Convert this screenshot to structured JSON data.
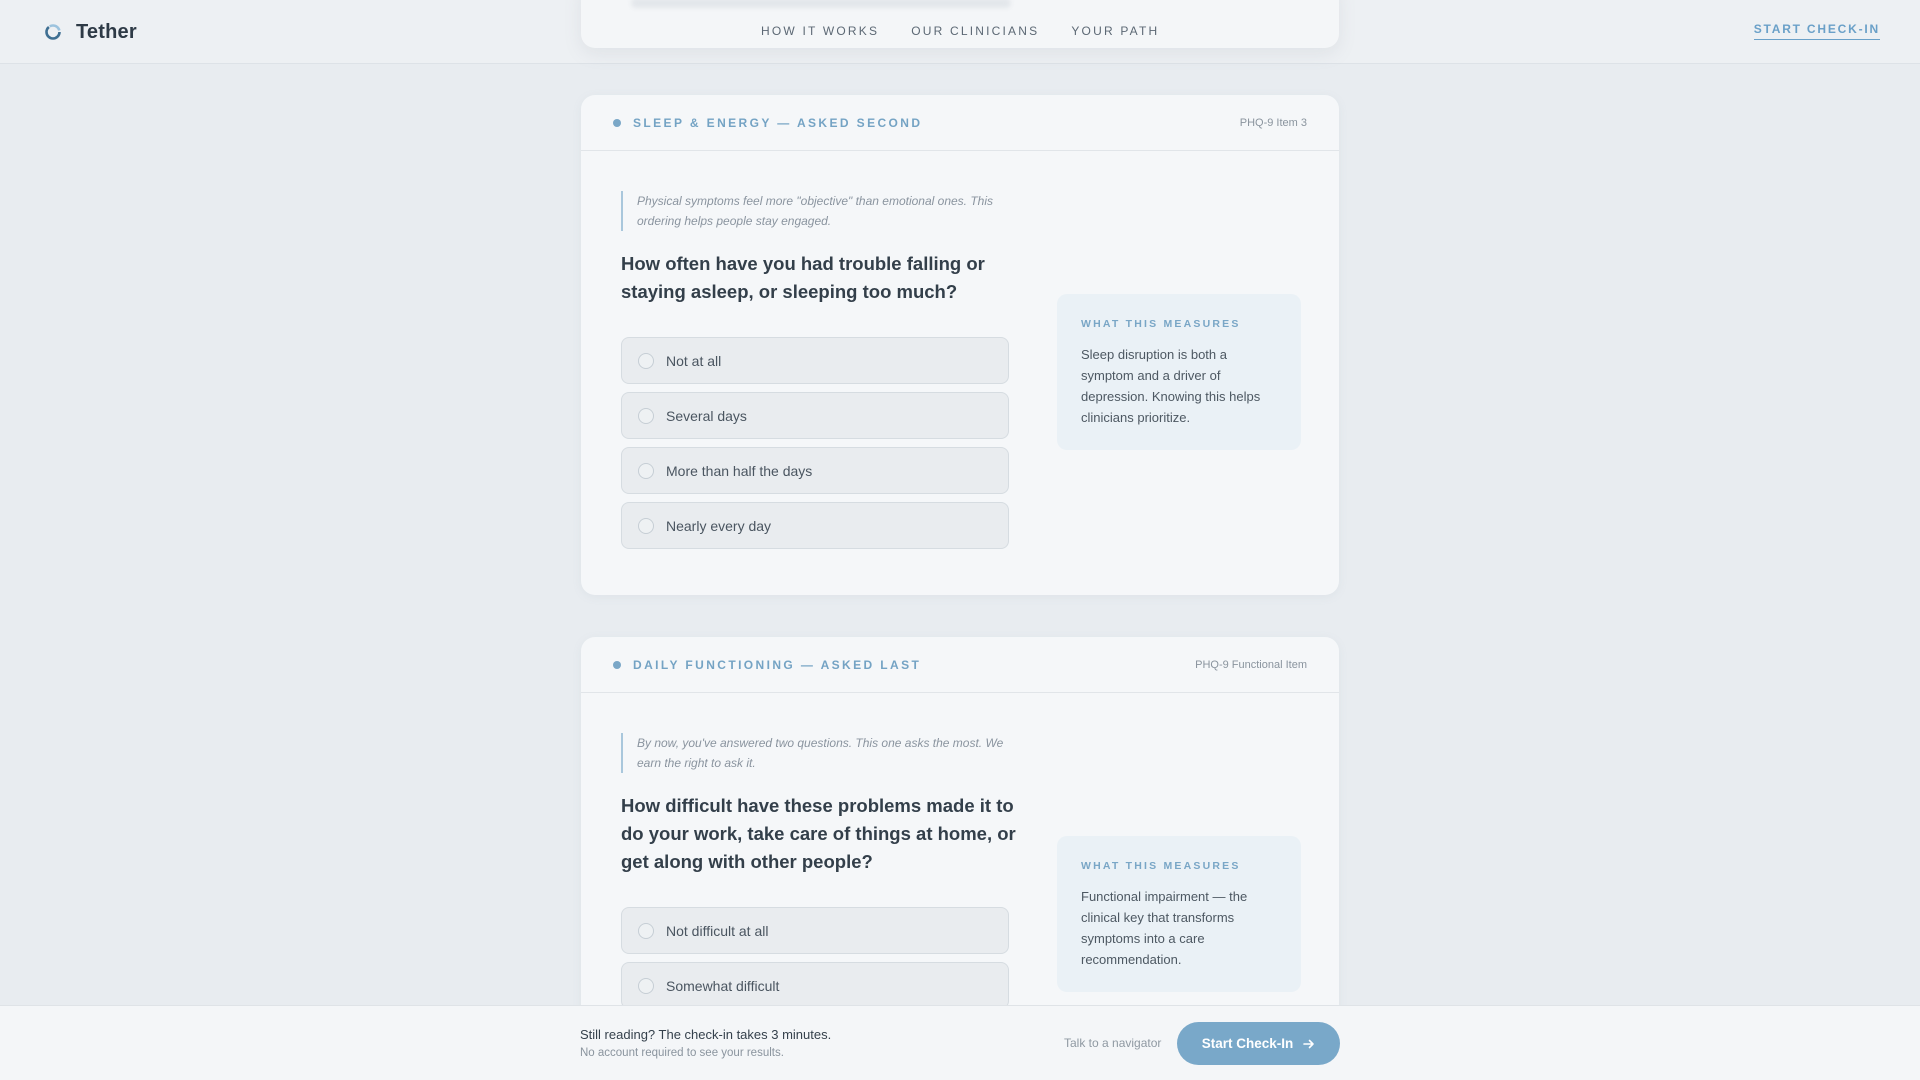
{
  "brand": {
    "name": "Tether",
    "icon": "tether-logo-icon"
  },
  "nav": {
    "links": [
      "HOW IT WORKS",
      "OUR CLINICIANS",
      "YOUR PATH"
    ],
    "cta": "START CHECK-IN"
  },
  "cards": [
    {
      "section": "SLEEP & ENERGY — ASKED SECOND",
      "ref": "PHQ-9 Item 3",
      "note": "Physical symptoms feel more \"objective\" than emotional ones. This ordering helps people stay engaged.",
      "question": "How often have you had trouble falling or staying asleep, or sleeping too much?",
      "options": [
        "Not at all",
        "Several days",
        "More than half the days",
        "Nearly every day"
      ],
      "measure": {
        "title": "WHAT THIS MEASURES",
        "text": "Sleep disruption is both a symptom and a driver of depression. Knowing this helps clinicians prioritize."
      }
    },
    {
      "section": "DAILY FUNCTIONING — ASKED LAST",
      "ref": "PHQ-9 Functional Item",
      "note": "By now, you've answered two questions. This one asks the most. We earn the right to ask it.",
      "question": "How difficult have these problems made it to do your work, take care of things at home, or get along with other people?",
      "options": [
        "Not difficult at all",
        "Somewhat difficult"
      ],
      "measure": {
        "title": "WHAT THIS MEASURES",
        "text": "Functional impairment — the clinical key that transforms symptoms into a care recommendation."
      }
    }
  ],
  "bottom_bar": {
    "main": "Still reading? The check-in takes 3 minutes.",
    "sub": "No account required to see your results.",
    "link": "Talk to a navigator",
    "button": "Start Check-In",
    "button_icon": "arrow-right-icon"
  },
  "colors": {
    "accent": "#79a8c9",
    "background": "#e8ecf0",
    "card": "#f5f7f9"
  }
}
